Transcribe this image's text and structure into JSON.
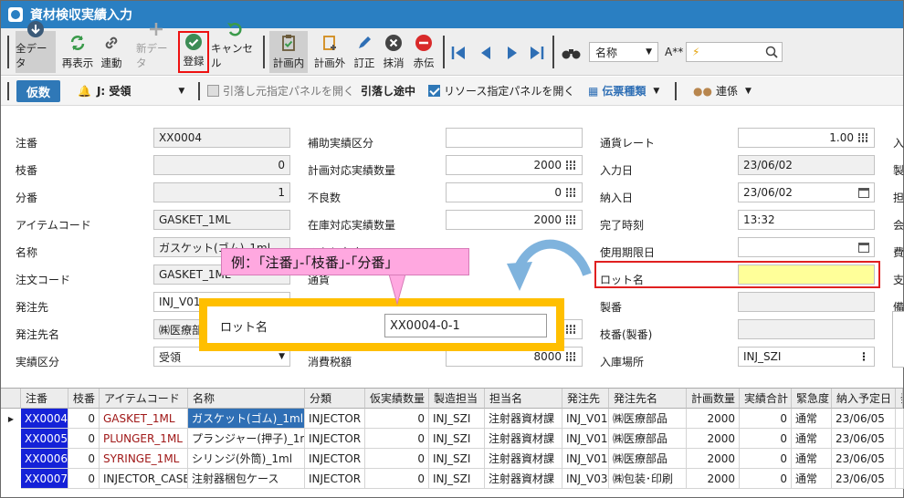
{
  "window": {
    "title": "資材検収実績入力"
  },
  "toolbar": {
    "all_data": "全データ",
    "refresh": "再表示",
    "link": "連動",
    "new_data": "新データ",
    "register": "登録",
    "cancel": "キャンセル",
    "in_plan": "計画内",
    "out_plan": "計画外",
    "correct": "訂正",
    "delete": "抹消",
    "red": "赤伝",
    "search_field": "名称",
    "search_mode": "A**",
    "search_value": "⚡"
  },
  "toolbar2": {
    "kari": "仮数",
    "type": "J: 受領",
    "pull_panel": "引落し元指定パネルを開く",
    "pulling": "引落し途中",
    "resource_panel": "リソース指定パネルを開く",
    "slip_type": "伝票種類",
    "relation": "連係"
  },
  "form": {
    "c1": [
      {
        "label": "注番",
        "value": "XX0004"
      },
      {
        "label": "枝番",
        "value": "0"
      },
      {
        "label": "分番",
        "value": "1"
      },
      {
        "label": "アイテムコード",
        "value": "GASKET_1ML"
      },
      {
        "label": "名称",
        "value": "ガスケット(ゴム)_1ml"
      },
      {
        "label": "注文コード",
        "value": "GASKET_1ML"
      },
      {
        "label": "発注先",
        "value": "INJ_V01"
      },
      {
        "label": "発注先名",
        "value": "㈱医療部"
      },
      {
        "label": "実績区分",
        "value": "受領"
      }
    ],
    "c2": [
      {
        "label": "補助実績区分",
        "value": ""
      },
      {
        "label": "計画対応実績数量",
        "value": "2000"
      },
      {
        "label": "不良数",
        "value": "0"
      },
      {
        "label": "在庫対応実績数量",
        "value": "2000"
      },
      {
        "label": "みなし在庫",
        "value": ""
      },
      {
        "label": "通貨",
        "value": ""
      },
      {
        "label": "",
        "value": ""
      },
      {
        "label": "",
        "value": ""
      },
      {
        "label": "消費税額",
        "value": "8000"
      }
    ],
    "c3": [
      {
        "label": "通貨レート",
        "value": "1.00"
      },
      {
        "label": "入力日",
        "value": "23/06/02"
      },
      {
        "label": "納入日",
        "value": "23/06/02"
      },
      {
        "label": "完了時刻",
        "value": "13:32"
      },
      {
        "label": "使用期限日",
        "value": ""
      },
      {
        "label": "ロット名",
        "value": ""
      },
      {
        "label": "製番",
        "value": ""
      },
      {
        "label": "枝番(製番)",
        "value": ""
      },
      {
        "label": "入庫場所",
        "value": "INJ_SZI"
      }
    ],
    "c4": [
      "入",
      "製",
      "担",
      "会",
      "費",
      "支",
      "備"
    ]
  },
  "annotation": {
    "callout": "例：｢注番｣-｢枝番｣-｢分番｣",
    "lot_label": "ロット名",
    "lot_value": "XX0004-0-1"
  },
  "table": {
    "headers": [
      "注番",
      "枝番",
      "アイテムコード",
      "名称",
      "分類",
      "仮実績数量",
      "製造担当",
      "担当名",
      "発注先",
      "発注先名",
      "計画数量",
      "実績合計",
      "緊急度",
      "納入予定日",
      "発"
    ],
    "rows": [
      [
        "XX0004",
        "0",
        "GASKET_1ML",
        "ガスケット(ゴム)_1ml",
        "INJECTOR",
        "0",
        "INJ_SZI",
        "注射器資材課",
        "INJ_V01",
        "㈱医療部品",
        "2000",
        "0",
        "通常",
        "23/06/05",
        ""
      ],
      [
        "XX0005",
        "0",
        "PLUNGER_1ML",
        "プランジャー(押子)_1ml",
        "INJECTOR",
        "0",
        "INJ_SZI",
        "注射器資材課",
        "INJ_V01",
        "㈱医療部品",
        "2000",
        "0",
        "通常",
        "23/06/05",
        ""
      ],
      [
        "XX0006",
        "0",
        "SYRINGE_1ML",
        "シリンジ(外筒)_1ml",
        "INJECTOR",
        "0",
        "INJ_SZI",
        "注射器資材課",
        "INJ_V01",
        "㈱医療部品",
        "2000",
        "0",
        "通常",
        "23/06/05",
        ""
      ],
      [
        "XX0007",
        "0",
        "INJECTOR_CASE",
        "注射器梱包ケース",
        "INJECTOR",
        "0",
        "INJ_SZI",
        "注射器資材課",
        "INJ_V03",
        "㈱包装･印刷",
        "2000",
        "0",
        "通常",
        "23/06/05",
        ""
      ]
    ]
  }
}
